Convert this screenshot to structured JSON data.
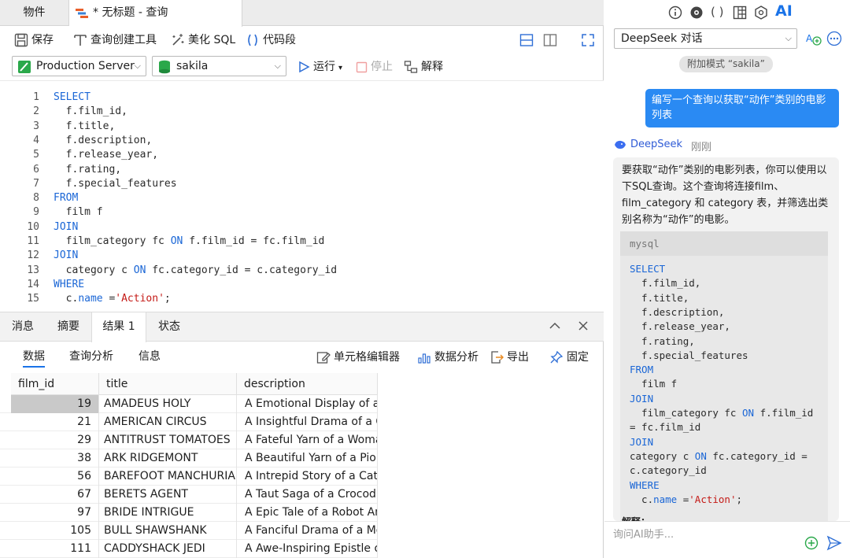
{
  "tabs": {
    "objects": "物件",
    "query": "* 无标题 - 查询"
  },
  "toolbar": {
    "save": "保存",
    "query_builder": "查询创建工具",
    "beautify": "美化 SQL",
    "snippet": "代码段"
  },
  "connection": {
    "server": "Production Server",
    "database": "sakila",
    "run": "运行",
    "stop": "停止",
    "explain": "解释"
  },
  "editor": {
    "line_numbers": [
      "1",
      "2",
      "3",
      "4",
      "5",
      "6",
      "7",
      "8",
      "9",
      "10",
      "11",
      "12",
      "13",
      "14",
      "15"
    ]
  },
  "result_tabs": {
    "messages": "消息",
    "summary": "摘要",
    "result1": "结果 1",
    "status": "状态"
  },
  "subtabs": {
    "data": "数据",
    "query_analysis": "查询分析",
    "info": "信息",
    "cell_editor": "单元格编辑器",
    "data_analysis": "数据分析",
    "export": "导出",
    "pin": "固定"
  },
  "grid": {
    "columns": [
      "film_id",
      "title",
      "description"
    ],
    "rows": [
      [
        "19",
        "AMADEUS HOLY",
        "A Emotional Display of a P"
      ],
      [
        "21",
        "AMERICAN CIRCUS",
        "A Insightful Drama of a Gir"
      ],
      [
        "29",
        "ANTITRUST TOMATOES",
        "A Fateful Yarn of a Womar"
      ],
      [
        "38",
        "ARK RIDGEMONT",
        "A Beautiful Yarn of a Pione"
      ],
      [
        "56",
        "BAREFOOT MANCHURIAN",
        "A Intrepid Story of a Cat Ar"
      ],
      [
        "67",
        "BERETS AGENT",
        "A Taut Saga of a Crocodile"
      ],
      [
        "97",
        "BRIDE INTRIGUE",
        "A Epic Tale of a Robot And"
      ],
      [
        "105",
        "BULL SHAWSHANK",
        "A Fanciful Drama of a Moc"
      ],
      [
        "111",
        "CADDYSHACK JEDI",
        "A Awe-Inspiring Epistle of"
      ]
    ]
  },
  "ai": {
    "label": "AI",
    "conversation": "DeepSeek 对话",
    "attach_mode": "附加模式 “sakila”",
    "user_message": "编写一个查询以获取“动作”类别的电影列表",
    "assistant_name": "DeepSeek",
    "timestamp": "刚刚",
    "answer": "要获取“动作”类别的电影列表，你可以使用以下SQL查询。这个查询将连接film、film_category 和 category 表，并筛选出类别名称为“动作”的电影。",
    "code_lang": "mysql",
    "explain_label": "解释：",
    "input_placeholder": "询问AI助手..."
  },
  "colors": {
    "keyword": "#1a66d6",
    "string": "#c41a16",
    "accent": "#1a73e8",
    "user_bubble": "#2a8af3"
  }
}
